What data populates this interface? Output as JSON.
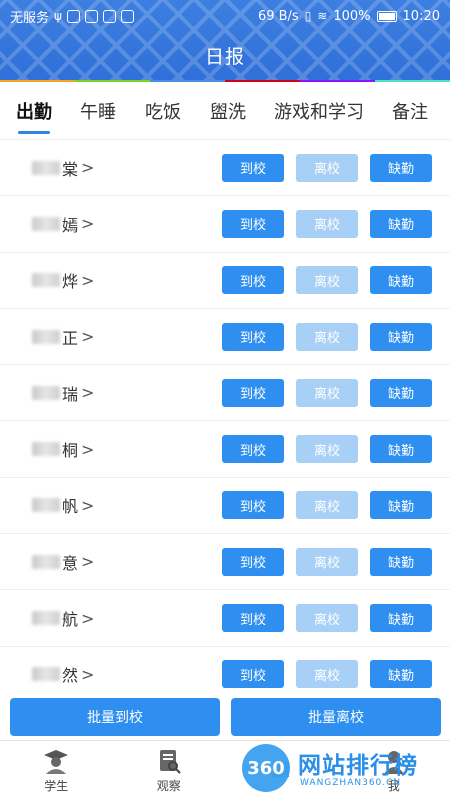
{
  "status_bar": {
    "carrier": "无服务",
    "net_speed": "69 B/s",
    "battery": "100%",
    "time": "10:20"
  },
  "header": {
    "title": "日报"
  },
  "tabs": [
    {
      "label": "出勤",
      "active": true
    },
    {
      "label": "午睡",
      "active": false
    },
    {
      "label": "吃饭",
      "active": false
    },
    {
      "label": "盥洗",
      "active": false
    },
    {
      "label": "游戏和学习",
      "active": false
    },
    {
      "label": "备注",
      "active": false
    }
  ],
  "students": [
    {
      "name_visible": "棠"
    },
    {
      "name_visible": "嫣"
    },
    {
      "name_visible": "烨"
    },
    {
      "name_visible": "正"
    },
    {
      "name_visible": "瑞"
    },
    {
      "name_visible": "桐"
    },
    {
      "name_visible": "帆"
    },
    {
      "name_visible": "意"
    },
    {
      "name_visible": "航"
    },
    {
      "name_visible": "然"
    }
  ],
  "row_buttons": {
    "arrive": "到校",
    "leave": "离校",
    "absent": "缺勤"
  },
  "batch": {
    "arrive": "批量到校",
    "leave": "批量离校"
  },
  "bottom_nav": [
    {
      "label": "学生",
      "icon": "graduate-icon"
    },
    {
      "label": "观察",
      "icon": "observe-icon"
    },
    {
      "label": "",
      "icon": "home-icon"
    },
    {
      "label": "我",
      "icon": "profile-icon"
    }
  ],
  "watermark": {
    "badge": "360",
    "text": "网站排行榜",
    "sub": "WANGZHAN360.CN"
  },
  "colors": {
    "primary": "#2f8ff0",
    "disabled": "#a8d0f6",
    "header": "#3178dc"
  },
  "rainbow": [
    "#f5a623",
    "#7ed321",
    "#4a90e2",
    "#d0021b",
    "#9013fe",
    "#50e3c2"
  ]
}
